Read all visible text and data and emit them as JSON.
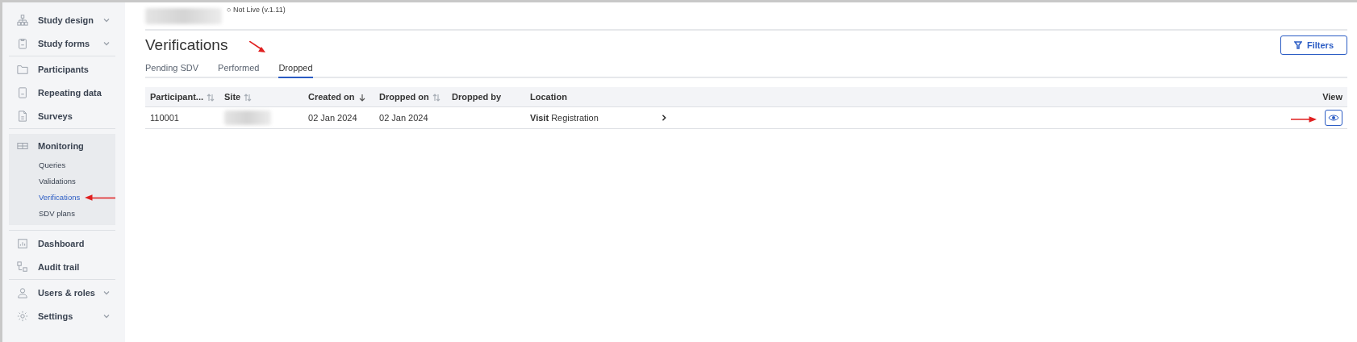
{
  "sidebar": {
    "sections": [
      {
        "items": [
          {
            "label": "Study design",
            "expandable": true
          },
          {
            "label": "Study forms",
            "expandable": true
          }
        ]
      },
      {
        "items": [
          {
            "label": "Participants",
            "expandable": false
          },
          {
            "label": "Repeating data",
            "expandable": false
          },
          {
            "label": "Surveys",
            "expandable": false
          }
        ]
      },
      {
        "items": [
          {
            "label": "Monitoring",
            "expandable": false,
            "expanded": true,
            "children": [
              {
                "label": "Queries",
                "selected": false
              },
              {
                "label": "Validations",
                "selected": false
              },
              {
                "label": "Verifications",
                "selected": true
              },
              {
                "label": "SDV plans",
                "selected": false
              }
            ]
          }
        ]
      },
      {
        "items": [
          {
            "label": "Dashboard",
            "expandable": false
          },
          {
            "label": "Audit trail",
            "expandable": false
          }
        ]
      },
      {
        "items": [
          {
            "label": "Users & roles",
            "expandable": true
          },
          {
            "label": "Settings",
            "expandable": true
          }
        ]
      }
    ]
  },
  "header": {
    "status": "○ Not Live (v.1.11)"
  },
  "page": {
    "title": "Verifications",
    "filters_button": "Filters"
  },
  "tabs": [
    {
      "label": "Pending SDV",
      "selected": false
    },
    {
      "label": "Performed",
      "selected": false
    },
    {
      "label": "Dropped",
      "selected": true
    }
  ],
  "table": {
    "columns": [
      {
        "label": "Participant...",
        "sortable": true,
        "sorted": false
      },
      {
        "label": "Site",
        "sortable": true,
        "sorted": false
      },
      {
        "label": "Created on",
        "sortable": true,
        "sorted": true
      },
      {
        "label": "Dropped on",
        "sortable": true,
        "sorted": false
      },
      {
        "label": "Dropped by",
        "sortable": false
      },
      {
        "label": "Location",
        "sortable": false
      },
      {
        "label": "View",
        "sortable": false
      }
    ],
    "rows": [
      {
        "participant": "110001",
        "created_on": "02 Jan 2024",
        "dropped_on": "02 Jan 2024",
        "location_kind": "Visit",
        "location": "Registration"
      }
    ]
  }
}
